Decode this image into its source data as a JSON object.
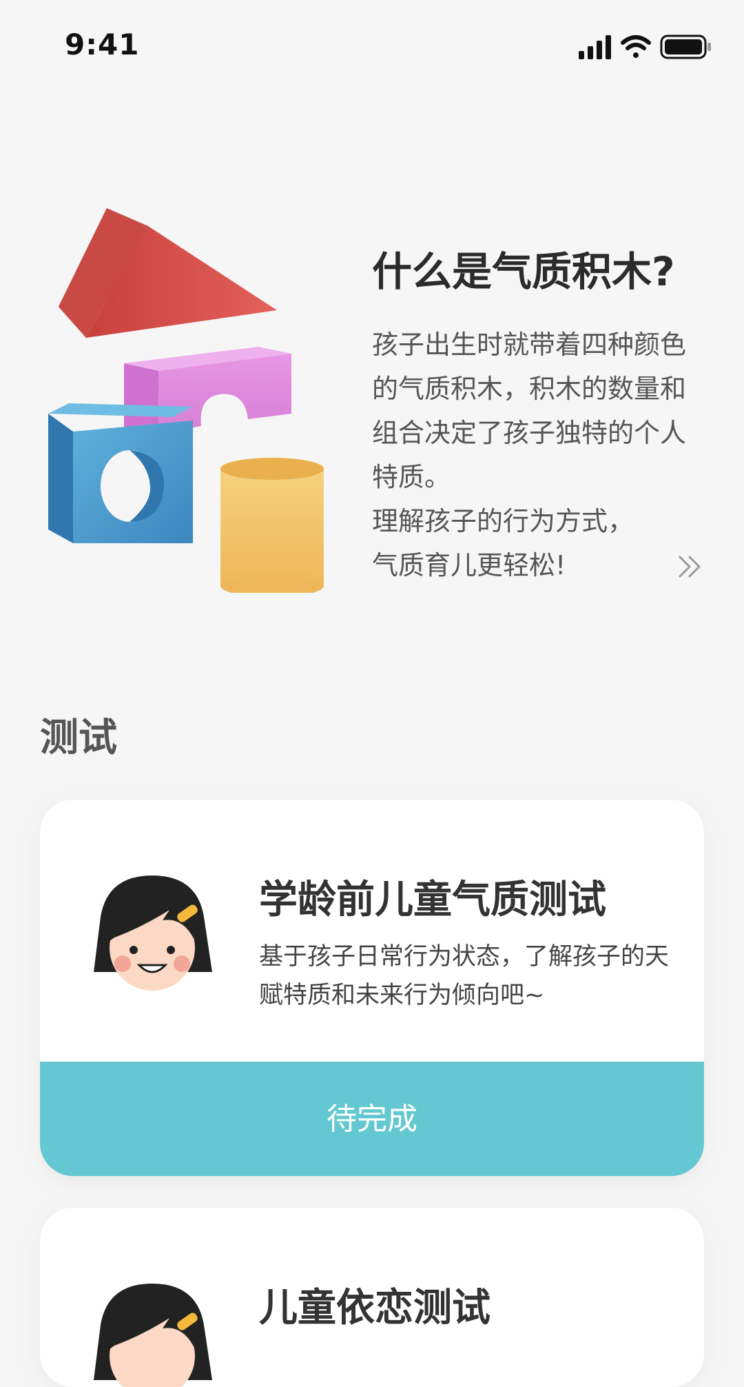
{
  "status_bar": {
    "time": "9:41"
  },
  "intro": {
    "title": "什么是气质积木?",
    "description_lines": [
      "孩子出生时就带着四种颜色",
      "的气质积木，积木的数量和",
      "组合决定了孩子独特的个人",
      "特质。",
      "理解孩子的行为方式，",
      "气质育儿更轻松!"
    ],
    "more_icon": "double-chevron-right-icon"
  },
  "tests_section": {
    "title": "测试",
    "cards": [
      {
        "title": "学龄前儿童气质测试",
        "description": "基于孩子日常行为状态，了解孩子的天赋特质和未来行为倾向吧~",
        "action_label": "待完成",
        "avatar_icon": "girl-avatar-icon"
      },
      {
        "title": "儿童依恋测试",
        "avatar_icon": "girl-avatar-icon"
      }
    ]
  },
  "colors": {
    "background": "#f6f6f6",
    "accent": "#63c8d1",
    "block_red": "#dd5550",
    "block_pink": "#e08ade",
    "block_blue": "#4a98cc",
    "block_yellow": "#f0c266"
  }
}
